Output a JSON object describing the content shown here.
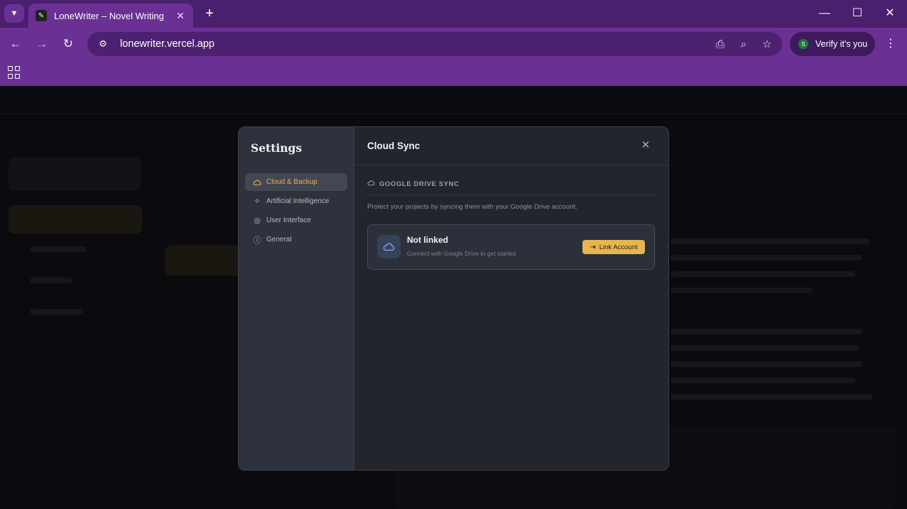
{
  "browser": {
    "tab": {
      "title": "LoneWriter – Novel Writing",
      "favicon": "pen-icon"
    },
    "url": "lonewriter.vercel.app",
    "profile_button": {
      "label": "Verify it's you",
      "avatar_letter": "S"
    },
    "colors": {
      "frame": "#6a3094",
      "tabstrip": "#4a1f6e",
      "omnibox": "#4c2170"
    }
  },
  "settings_modal": {
    "title": "Settings",
    "nav": [
      {
        "label": "Cloud & Backup",
        "icon": "cloud-icon",
        "active": true
      },
      {
        "label": "Artificial Intelligence",
        "icon": "sparkles-icon",
        "active": false
      },
      {
        "label": "User Interface",
        "icon": "palette-icon",
        "active": false
      },
      {
        "label": "General",
        "icon": "info-icon",
        "active": false
      }
    ],
    "panel": {
      "title": "Cloud Sync",
      "section_title": "GOOGLE DRIVE SYNC",
      "description": "Protect your projects by syncing them with your Google Drive account.",
      "card": {
        "status": "Not linked",
        "subtitle": "Connect with Google Drive to get started",
        "button_label": "Link Account"
      }
    },
    "colors": {
      "accent": "#e8b551",
      "panel": "#22252c",
      "sidebar": "#2e323c"
    }
  }
}
